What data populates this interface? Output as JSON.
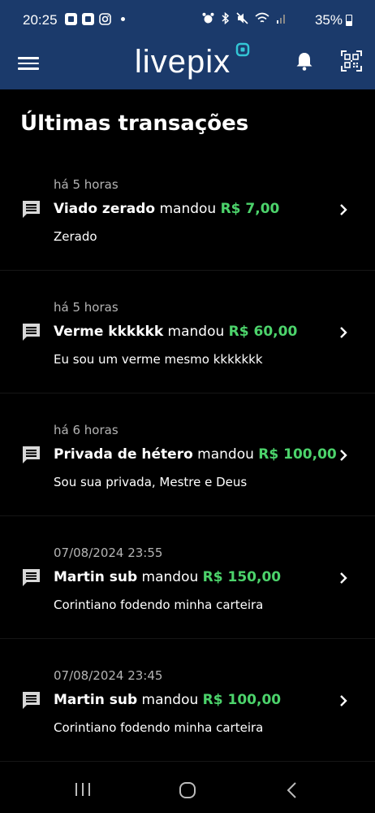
{
  "status_bar": {
    "time": "20:25",
    "battery": "35%",
    "left_icons": [
      "app-notification-icon",
      "app-notification-icon",
      "instagram-icon",
      "more-dot-icon"
    ],
    "right_icons": [
      "alarm-icon",
      "bluetooth-icon",
      "mute-icon",
      "wifi-icon",
      "signal-icon",
      "battery-icon"
    ]
  },
  "app_bar": {
    "logo_text": "livepix",
    "background": "#1b3a6b",
    "icons": [
      "menu-icon",
      "bell-icon",
      "qr-code-icon"
    ]
  },
  "page": {
    "title": "Últimas transações"
  },
  "transactions": [
    {
      "time": "há 5 horas",
      "name": "Viado zerado",
      "verb": "mandou",
      "amount": "R$ 7,00",
      "message": "Zerado"
    },
    {
      "time": "há 5 horas",
      "name": "Verme kkkkkk",
      "verb": "mandou",
      "amount": "R$ 60,00",
      "message": "Eu sou um verme mesmo kkkkkkk"
    },
    {
      "time": "há 6 horas",
      "name": "Privada de hétero",
      "verb": "mandou",
      "amount": "R$ 100,00",
      "message": "Sou sua privada, Mestre e Deus"
    },
    {
      "time": "07/08/2024 23:55",
      "name": "Martin sub",
      "verb": "mandou",
      "amount": "R$ 150,00",
      "message": "Corintiano fodendo minha carteira"
    },
    {
      "time": "07/08/2024 23:45",
      "name": "Martin sub",
      "verb": "mandou",
      "amount": "R$ 100,00",
      "message": "Corintiano fodendo minha carteira"
    }
  ],
  "colors": {
    "amount": "#4cd36b",
    "background": "#000000",
    "muted_text": "#b4b4b4"
  },
  "nav_bar": {
    "icons": [
      "recent-apps-icon",
      "home-icon",
      "back-icon"
    ]
  }
}
